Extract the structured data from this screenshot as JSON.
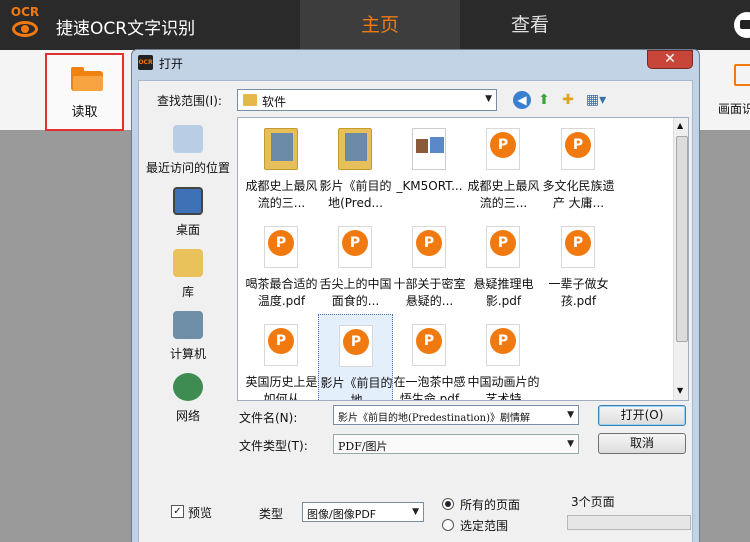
{
  "app": {
    "logo_text": "OCR",
    "title": "捷速OCR文字识别",
    "tabs": [
      {
        "label": "主页",
        "active": true
      },
      {
        "label": "查看",
        "active": false
      }
    ]
  },
  "toolbar": {
    "read_label": "读取",
    "screenshot_label": "画面识"
  },
  "dialog": {
    "title": "打开",
    "close_glyph": "✕",
    "look_in_label": "查找范围(I):",
    "look_in_value": "软件",
    "places": [
      {
        "label": "最近访问的位置",
        "icon": "recent-places-icon"
      },
      {
        "label": "桌面",
        "icon": "desktop-icon"
      },
      {
        "label": "库",
        "icon": "libraries-icon"
      },
      {
        "label": "计算机",
        "icon": "computer-icon"
      },
      {
        "label": "网络",
        "icon": "network-icon"
      }
    ],
    "files": [
      {
        "kind": "folder",
        "label": "成都史上最风流的三..."
      },
      {
        "kind": "folder",
        "label": "影片《前目的地(Pred..."
      },
      {
        "kind": "image",
        "label": "_KM5ORT..."
      },
      {
        "kind": "pdf",
        "label": "成都史上最风流的三..."
      },
      {
        "kind": "pdf",
        "label": "多文化民族遗产 大庸..."
      },
      {
        "kind": "pdf",
        "label": "喝茶最合适的温度.pdf"
      },
      {
        "kind": "pdf",
        "label": "舌尖上的中国面食的..."
      },
      {
        "kind": "pdf",
        "label": "十部关于密室悬疑的..."
      },
      {
        "kind": "pdf",
        "label": "悬疑推理电影.pdf"
      },
      {
        "kind": "pdf",
        "label": "一辈子做女孩.pdf"
      },
      {
        "kind": "pdf",
        "label": "英国历史上是如何从"
      },
      {
        "kind": "pdf",
        "label": "影片《前目的地",
        "selected": true
      },
      {
        "kind": "pdf",
        "label": "在一泡茶中感悟生命.pdf"
      },
      {
        "kind": "pdf",
        "label": "中国动画片的艺术特"
      }
    ],
    "pdf_badge": "P",
    "file_name_label": "文件名(N):",
    "file_name_value": "影片《前目的地(Predestination)》剧情解",
    "file_type_label": "文件类型(T):",
    "file_type_value": "PDF/图片",
    "open_button": "打开(O)",
    "cancel_button": "取消",
    "preview_checkbox_label": "预览",
    "preview_checked": true,
    "type_label": "类型",
    "type_value": "图像/图像PDF",
    "all_pages_label": "所有的页面",
    "selected_range_label": "选定范围",
    "page_count": "3个页面",
    "preview_group_label": "预览"
  }
}
